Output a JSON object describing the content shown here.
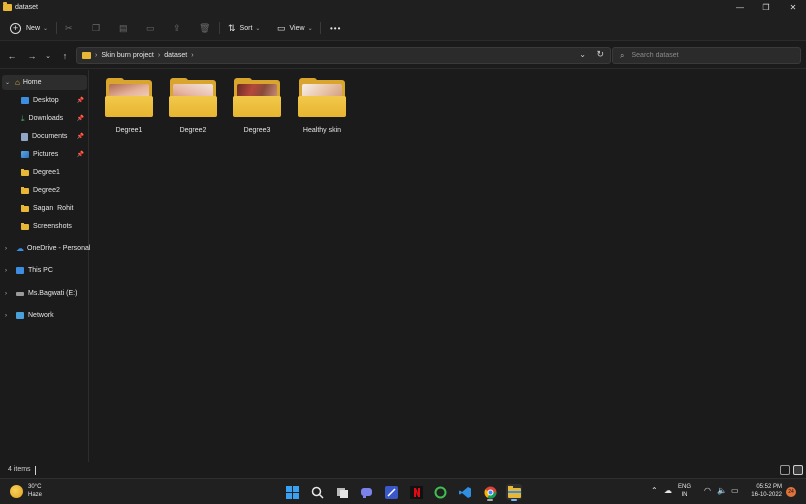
{
  "window": {
    "title": "dataset"
  },
  "toolbar": {
    "new_label": "New",
    "sort_label": "Sort",
    "view_label": "View",
    "more_label": "•••"
  },
  "address": {
    "crumbs": [
      "Skin burn project",
      "dataset"
    ]
  },
  "search": {
    "placeholder": "Search dataset"
  },
  "sidebar": {
    "home": "Home",
    "quick": [
      {
        "label": "Desktop"
      },
      {
        "label": "Downloads"
      },
      {
        "label": "Documents"
      },
      {
        "label": "Pictures"
      },
      {
        "label": "Degree1"
      },
      {
        "label": "Degree2"
      },
      {
        "label": "Sagan  Rohit"
      },
      {
        "label": "Screenshots"
      }
    ],
    "onedrive": "OneDrive - Personal",
    "thispc": "This PC",
    "drive": "Ms.Bagwati (E:)",
    "network": "Network"
  },
  "folders": [
    {
      "name": "Degree1"
    },
    {
      "name": "Degree2"
    },
    {
      "name": "Degree3"
    },
    {
      "name": "Healthy skin"
    }
  ],
  "status": {
    "count": "4 items"
  },
  "taskbar": {
    "temp": "30°C",
    "weather": "Haze",
    "lang1": "ENG",
    "lang2": "IN",
    "time": "05:52 PM",
    "date": "16-10-2022",
    "badge": "24"
  },
  "colors": {
    "folder": "#e8b735",
    "accent": "#7ab7ff",
    "background": "#1b1b1b"
  }
}
